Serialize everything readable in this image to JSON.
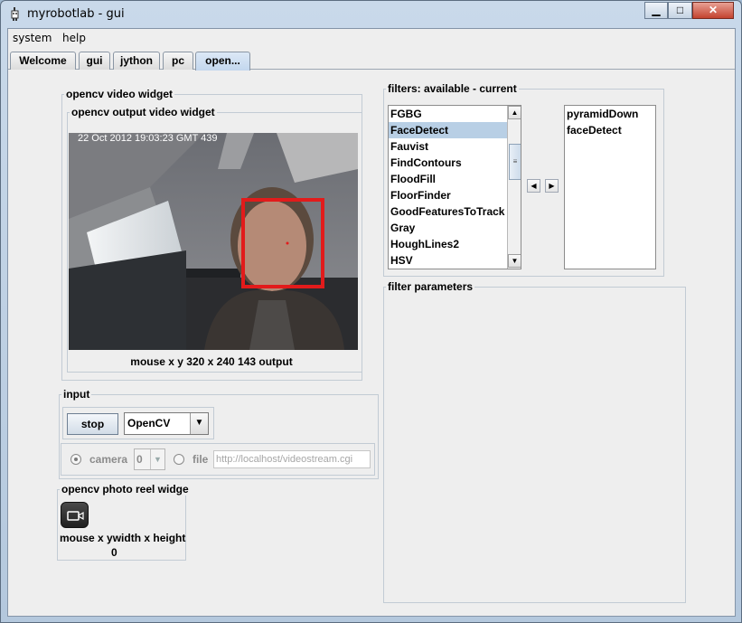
{
  "window": {
    "title": "myrobotlab - gui",
    "minimize": "▁",
    "maximize": "□",
    "close": "✕"
  },
  "menu": [
    "system",
    "help"
  ],
  "tabs": [
    {
      "label": "Welcome",
      "active": false
    },
    {
      "label": "gui",
      "active": false
    },
    {
      "label": "jython",
      "active": false
    },
    {
      "label": "pc",
      "active": false
    },
    {
      "label": "open...",
      "active": true
    }
  ],
  "video_widget": {
    "title": "opencv  video widget",
    "output_title": "opencv output video widget",
    "timestamp": "22 Oct 2012 19:03:23 GMT 439",
    "status": "mouse x y   320 x 240  143  output"
  },
  "input": {
    "title": "input",
    "stop_label": "stop",
    "source_selected": "OpenCV",
    "camera_label": "camera",
    "camera_index": "0",
    "file_label": "file",
    "file_placeholder": "http://localhost/videostream.cgi",
    "selected_source_mode": "camera"
  },
  "photo_reel": {
    "title": "opencv  photo reel widge",
    "status": "mouse x ywidth x height",
    "count": "0"
  },
  "filters": {
    "title": "filters: available - current",
    "available": [
      "FGBG",
      "FaceDetect",
      "Fauvist",
      "FindContours",
      "FloodFill",
      "FloorFinder",
      "GoodFeaturesToTrack",
      "Gray",
      "HoughLines2",
      "HSV"
    ],
    "selected_available": "FaceDetect",
    "current": [
      "pyramidDown",
      "faceDetect"
    ],
    "add_arrow": "◀",
    "remove_arrow": "▶"
  },
  "filter_parameters": {
    "title": "filter parameters"
  },
  "colors": {
    "face_box": "#e21b1b",
    "selection": "#b8cfe5",
    "active_tab": "#c3d7ee"
  },
  "icons": [
    "robot-icon",
    "camera-icon",
    "chevron-down-icon",
    "scroll-up-icon",
    "scroll-down-icon"
  ]
}
